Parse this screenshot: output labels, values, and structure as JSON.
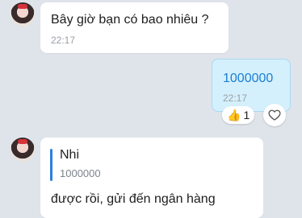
{
  "messages": [
    {
      "sender": "Nhi",
      "text": "Bây giờ bạn có bao nhiêu ?",
      "time": "22:17"
    },
    {
      "sender": "me",
      "text": "1000000",
      "time": "22:17",
      "reaction": {
        "emoji": "👍",
        "count": "1"
      }
    },
    {
      "sender": "Nhi",
      "quote": {
        "author": "Nhi",
        "text": "1000000"
      },
      "text": "được rồi, gửi đến ngân hàng"
    }
  ],
  "colors": {
    "background": "#dfe4ea",
    "sent_bubble": "#d5f0fd",
    "sent_text": "#1a7fd0",
    "quote_bar": "#2f7ee0"
  },
  "icons": {
    "avatar": "user-avatar",
    "reaction": "thumbs-up-icon",
    "react_button": "heart-outline-icon"
  }
}
